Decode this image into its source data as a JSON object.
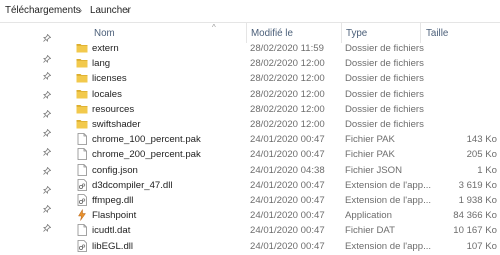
{
  "breadcrumb": [
    "Téléchargements",
    "Launcher"
  ],
  "columns": {
    "name": "Nom",
    "modified": "Modifié le",
    "type": "Type",
    "size": "Taille"
  },
  "files": [
    {
      "name": "extern",
      "modified": "28/02/2020 11:59",
      "type": "Dossier de fichiers",
      "size": "",
      "icon": "folder"
    },
    {
      "name": "lang",
      "modified": "28/02/2020 12:00",
      "type": "Dossier de fichiers",
      "size": "",
      "icon": "folder"
    },
    {
      "name": "licenses",
      "modified": "28/02/2020 12:00",
      "type": "Dossier de fichiers",
      "size": "",
      "icon": "folder"
    },
    {
      "name": "locales",
      "modified": "28/02/2020 12:00",
      "type": "Dossier de fichiers",
      "size": "",
      "icon": "folder"
    },
    {
      "name": "resources",
      "modified": "28/02/2020 12:00",
      "type": "Dossier de fichiers",
      "size": "",
      "icon": "folder"
    },
    {
      "name": "swiftshader",
      "modified": "28/02/2020 12:00",
      "type": "Dossier de fichiers",
      "size": "",
      "icon": "folder"
    },
    {
      "name": "chrome_100_percent.pak",
      "modified": "24/01/2020 00:47",
      "type": "Fichier PAK",
      "size": "143 Ko",
      "icon": "file"
    },
    {
      "name": "chrome_200_percent.pak",
      "modified": "24/01/2020 00:47",
      "type": "Fichier PAK",
      "size": "205 Ko",
      "icon": "file"
    },
    {
      "name": "config.json",
      "modified": "24/01/2020 04:38",
      "type": "Fichier JSON",
      "size": "1 Ko",
      "icon": "file"
    },
    {
      "name": "d3dcompiler_47.dll",
      "modified": "24/01/2020 00:47",
      "type": "Extension de l'app...",
      "size": "3 619 Ko",
      "icon": "dll"
    },
    {
      "name": "ffmpeg.dll",
      "modified": "24/01/2020 00:47",
      "type": "Extension de l'app...",
      "size": "1 938 Ko",
      "icon": "dll"
    },
    {
      "name": "Flashpoint",
      "modified": "24/01/2020 00:47",
      "type": "Application",
      "size": "84 366 Ko",
      "icon": "app"
    },
    {
      "name": "icudtl.dat",
      "modified": "24/01/2020 00:47",
      "type": "Fichier DAT",
      "size": "10 167 Ko",
      "icon": "file"
    },
    {
      "name": "libEGL.dll",
      "modified": "24/01/2020 00:47",
      "type": "Extension de l'app...",
      "size": "107 Ko",
      "icon": "dll"
    }
  ],
  "colors": {
    "folder": "#f2c94c",
    "folder_dark": "#dcae2e",
    "header_text": "#4c607a"
  }
}
